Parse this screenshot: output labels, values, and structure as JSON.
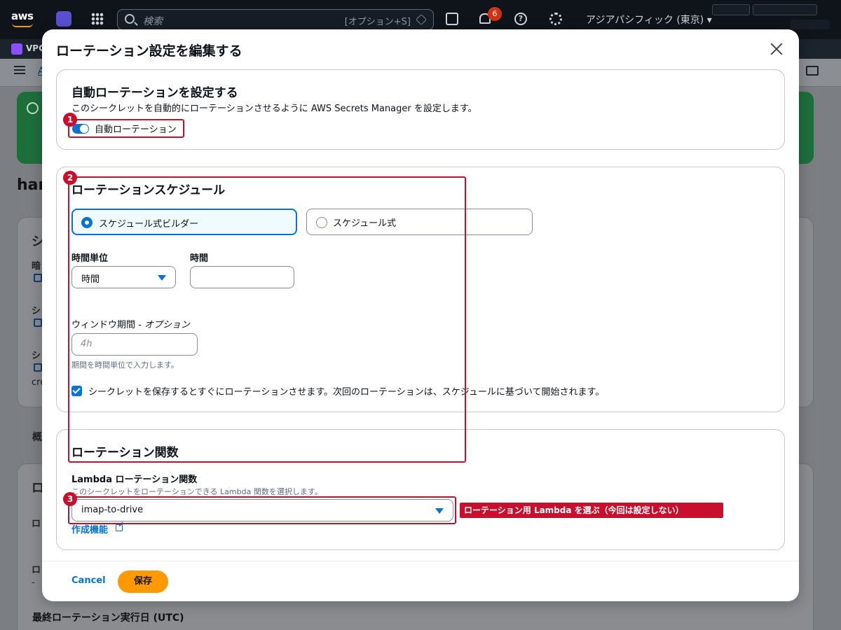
{
  "topnav": {
    "logo": "aws",
    "search_placeholder": "検索",
    "search_shortcut": "[オプション+S]",
    "notification_count": "6",
    "region": "アジアパシフィック (東京) ▾"
  },
  "favorites": {
    "vpc": "VPC"
  },
  "background": {
    "breadcrumb": "A",
    "page_title": "har",
    "card_heading": "シ",
    "tab": "概",
    "field_1": "暗",
    "field_2": "シ",
    "field_3": "シ",
    "field_3_value": "cre",
    "card2_heading": "ロ",
    "card2_field_1": "ロ",
    "card2_field_2": "ロ",
    "card2_dash": "-",
    "last_rotation": "最終ローテーション実行日 (UTC)"
  },
  "modal": {
    "title": "ローテーション設定を編集する",
    "auto_rotation": {
      "heading": "自動ローテーションを設定する",
      "description": "このシークレットを自動的にローテーションさせるように AWS Secrets Manager を設定します。",
      "toggle_label": "自動ローテーション",
      "toggle_on": true
    },
    "schedule": {
      "heading": "ローテーションスケジュール",
      "option_builder": "スケジュール式ビルダー",
      "option_expression": "スケジュール式",
      "selected_option": "スケジュール式ビルダー",
      "time_unit_label": "時間単位",
      "time_unit_value": "時間",
      "hours_label": "時間",
      "hours_value": "",
      "window_label": "ウィンドウ期間 - ",
      "window_label_optional": "オプション",
      "window_placeholder": "4h",
      "window_hint": "期間を時間単位で入力します。",
      "rotate_immediately_label": "シークレットを保存するとすぐにローテーションさせます。次回のローテーションは、スケジュールに基づいて開始されます。",
      "rotate_immediately_checked": true
    },
    "function": {
      "heading": "ローテーション関数",
      "lambda_label": "Lambda ローテーション関数",
      "lambda_hint": "このシークレットをローテーションできる Lambda 関数を選択します。",
      "lambda_value": "imap-to-drive",
      "create_link": "作成機能"
    },
    "footer": {
      "cancel": "Cancel",
      "save": "保存"
    }
  },
  "annotations": {
    "num_1": "1",
    "num_2": "2",
    "num_3": "3",
    "note_3": "ローテーション用 Lambda を選ぶ（今回は設定しない）"
  },
  "colors": {
    "primary": "#0972d3",
    "save_button": "#ff9900",
    "annotation": "#c8102e",
    "topnav": "#0f141a"
  }
}
